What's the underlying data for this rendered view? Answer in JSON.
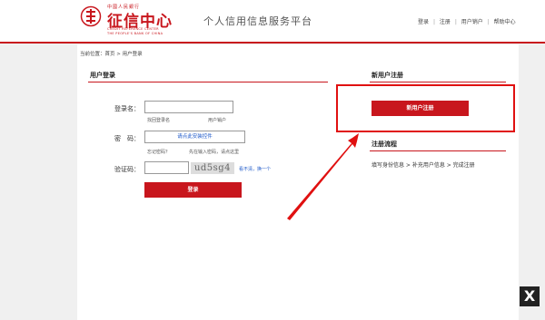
{
  "header": {
    "logo_top": "中國人民銀行",
    "logo_name": "征信中心",
    "logo_en_line1": "CREDIT REFERENCE CENTER",
    "logo_en_line2": "THE PEOPLE'S BANK OF CHINA",
    "site_title": "个人信用信息服务平台",
    "nav": {
      "login": "登录",
      "sep": "|",
      "register": "注册",
      "cancel_account": "用户销户",
      "help_center": "帮助中心"
    }
  },
  "breadcrumb": "当前位置：首页 > 用户登录",
  "login": {
    "title": "用户登录",
    "username_label": "登录名：",
    "username_value": "",
    "retrieve_name": "找回登录名",
    "cancel_account": "用户销户",
    "password_label": "密　码：",
    "install_control": "请点此安装控件",
    "forgot_password": "忘记密码？",
    "password_hint": "先在输入密码，请点这里",
    "captcha_label": "验证码：",
    "captcha_value": "",
    "captcha_text": "ud5sg4",
    "captcha_unclear": "看不清，换一个",
    "login_button": "登录"
  },
  "register": {
    "title": "新用户注册",
    "button": "新用户注册",
    "process_title": "注册流程",
    "process_steps": "填写身份信息 > 补充用户信息 > 完成注册"
  },
  "colors": {
    "brand_red": "#c8161d",
    "annotation_red": "#e01010",
    "link_blue": "#1a56c8"
  },
  "corner_badge": "X"
}
